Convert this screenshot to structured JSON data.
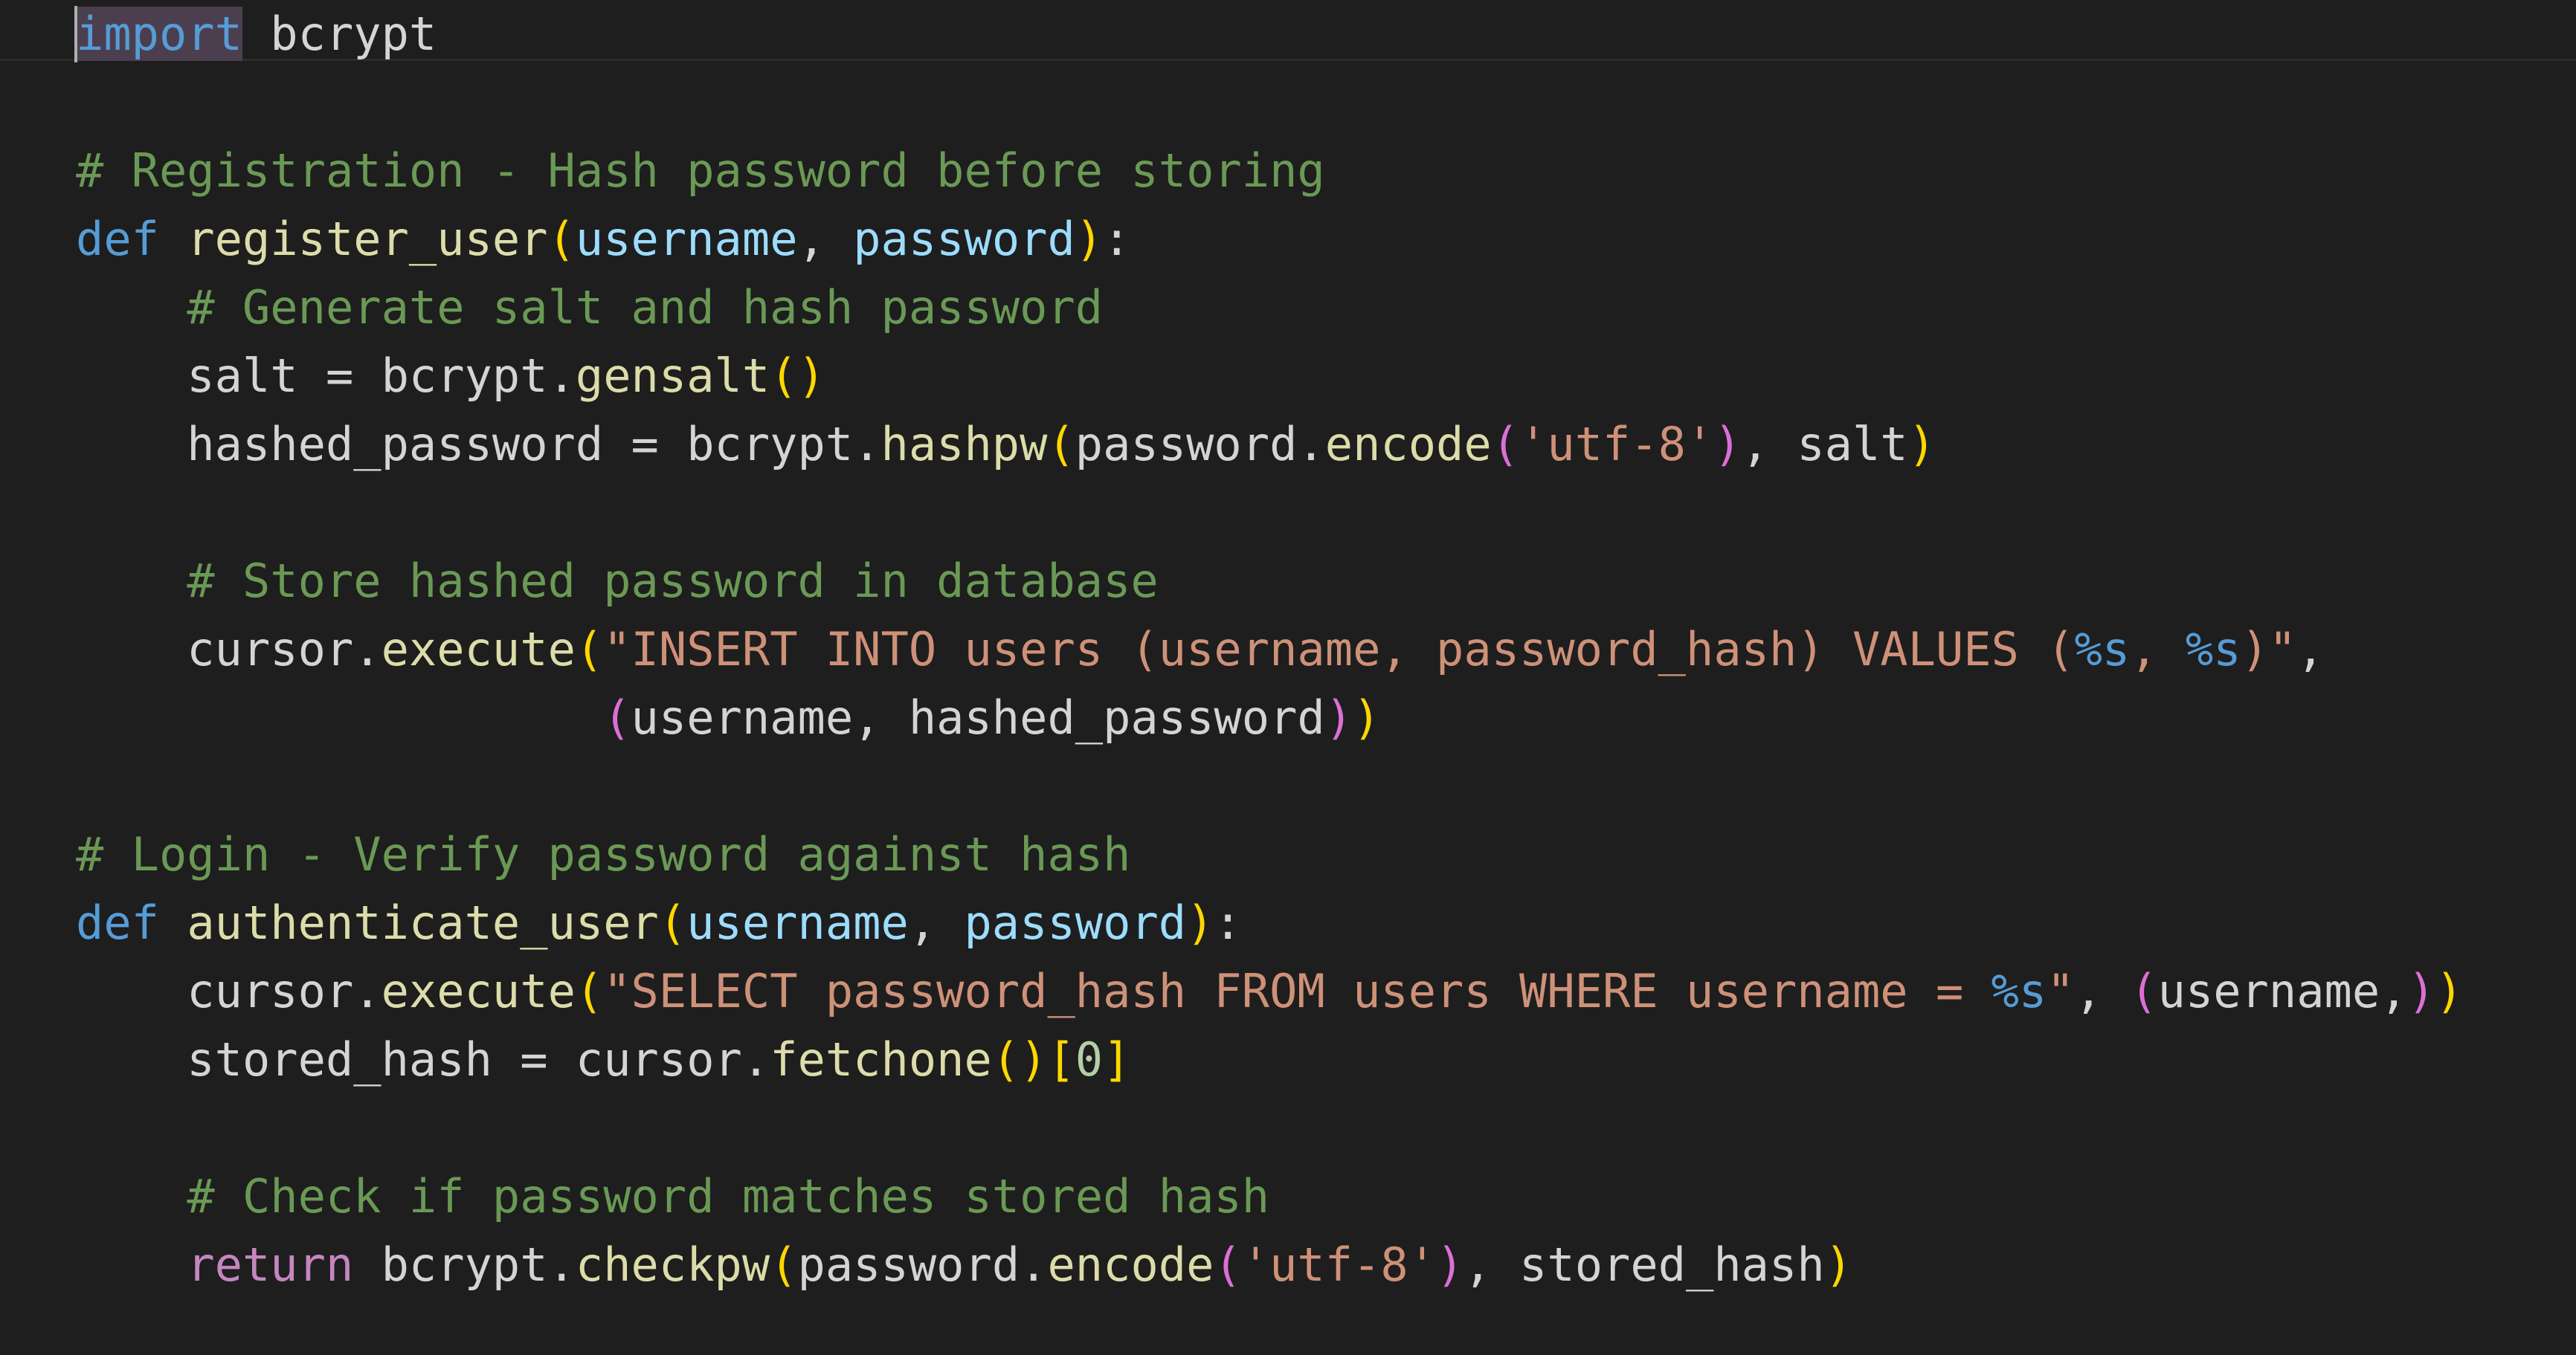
{
  "editor": {
    "language": "python",
    "theme_colors": {
      "background": "#1e1e1e",
      "keyword": "#569cd6",
      "control_keyword": "#c586c0",
      "function": "#dcdcaa",
      "parameter": "#9cdcfe",
      "string": "#ce9178",
      "comment": "#6a9955",
      "number": "#b5cea8",
      "bracket_level_1": "#ffd700",
      "bracket_level_2": "#da70d6"
    },
    "lines": [
      [
        [
          "kw",
          "import"
        ],
        [
          "var",
          " bcrypt"
        ]
      ],
      [],
      [
        [
          "cmt",
          "# Registration - Hash password before storing"
        ]
      ],
      [
        [
          "kw",
          "def"
        ],
        [
          "var",
          " "
        ],
        [
          "fn",
          "register_user"
        ],
        [
          "p1",
          "("
        ],
        [
          "param",
          "username"
        ],
        [
          "var",
          ", "
        ],
        [
          "param",
          "password"
        ],
        [
          "p1",
          ")"
        ],
        [
          "var",
          ":"
        ]
      ],
      [
        [
          "var",
          "    "
        ],
        [
          "cmt",
          "# Generate salt and hash password"
        ]
      ],
      [
        [
          "var",
          "    salt "
        ],
        [
          "op",
          "="
        ],
        [
          "var",
          " bcrypt."
        ],
        [
          "fn",
          "gensalt"
        ],
        [
          "p1",
          "()"
        ]
      ],
      [
        [
          "var",
          "    hashed_password "
        ],
        [
          "op",
          "="
        ],
        [
          "var",
          " bcrypt."
        ],
        [
          "fn",
          "hashpw"
        ],
        [
          "p1",
          "("
        ],
        [
          "var",
          "password."
        ],
        [
          "fn",
          "encode"
        ],
        [
          "p2",
          "("
        ],
        [
          "str",
          "'utf-8'"
        ],
        [
          "p2",
          ")"
        ],
        [
          "var",
          ", salt"
        ],
        [
          "p1",
          ")"
        ]
      ],
      [],
      [
        [
          "var",
          "    "
        ],
        [
          "cmt",
          "# Store hashed password in database"
        ]
      ],
      [
        [
          "var",
          "    cursor."
        ],
        [
          "fn",
          "execute"
        ],
        [
          "p1",
          "("
        ],
        [
          "str",
          "\"INSERT INTO users (username, password_hash) VALUES ("
        ],
        [
          "fmt",
          "%s"
        ],
        [
          "str",
          ", "
        ],
        [
          "fmt",
          "%s"
        ],
        [
          "str",
          ")\""
        ],
        [
          "var",
          ","
        ]
      ],
      [
        [
          "var",
          "                   "
        ],
        [
          "p2",
          "("
        ],
        [
          "var",
          "username, hashed_password"
        ],
        [
          "p2",
          ")"
        ],
        [
          "p1",
          ")"
        ]
      ],
      [],
      [
        [
          "cmt",
          "# Login - Verify password against hash"
        ]
      ],
      [
        [
          "kw",
          "def"
        ],
        [
          "var",
          " "
        ],
        [
          "fn",
          "authenticate_user"
        ],
        [
          "p1",
          "("
        ],
        [
          "param",
          "username"
        ],
        [
          "var",
          ", "
        ],
        [
          "param",
          "password"
        ],
        [
          "p1",
          ")"
        ],
        [
          "var",
          ":"
        ]
      ],
      [
        [
          "var",
          "    cursor."
        ],
        [
          "fn",
          "execute"
        ],
        [
          "p1",
          "("
        ],
        [
          "str",
          "\"SELECT password_hash FROM users WHERE username = "
        ],
        [
          "fmt",
          "%s"
        ],
        [
          "str",
          "\""
        ],
        [
          "var",
          ", "
        ],
        [
          "p2",
          "("
        ],
        [
          "var",
          "username,"
        ],
        [
          "p2",
          ")"
        ],
        [
          "p1",
          ")"
        ]
      ],
      [
        [
          "var",
          "    stored_hash "
        ],
        [
          "op",
          "="
        ],
        [
          "var",
          " cursor."
        ],
        [
          "fn",
          "fetchone"
        ],
        [
          "p1",
          "()"
        ],
        [
          "p1",
          "["
        ],
        [
          "num",
          "0"
        ],
        [
          "p1",
          "]"
        ]
      ],
      [],
      [
        [
          "var",
          "    "
        ],
        [
          "cmt",
          "# Check if password matches stored hash"
        ]
      ],
      [
        [
          "var",
          "    "
        ],
        [
          "ctl",
          "return"
        ],
        [
          "var",
          " bcrypt."
        ],
        [
          "fn",
          "checkpw"
        ],
        [
          "p1",
          "("
        ],
        [
          "var",
          "password."
        ],
        [
          "fn",
          "encode"
        ],
        [
          "p2",
          "("
        ],
        [
          "str",
          "'utf-8'"
        ],
        [
          "p2",
          ")"
        ],
        [
          "var",
          ", stored_hash"
        ],
        [
          "p1",
          ")"
        ]
      ]
    ]
  }
}
